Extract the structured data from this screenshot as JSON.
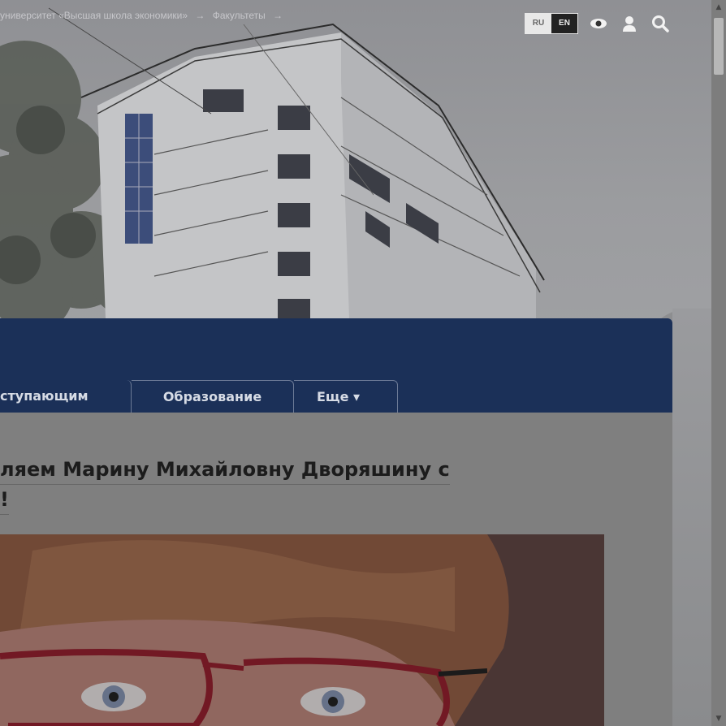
{
  "breadcrumbs": {
    "items": [
      "университет «Высшая школа экономики»",
      "→",
      "Факультеты",
      "→"
    ]
  },
  "header_utils": {
    "lang_ru": "RU",
    "lang_en": "EN"
  },
  "nav": {
    "tabs": [
      {
        "label": "ступающим"
      },
      {
        "label": "Образование"
      },
      {
        "label": "Еще ▾"
      }
    ]
  },
  "article": {
    "title_line1": "ляем Марину Михайловну Дворяшину с",
    "title_line2": "!"
  },
  "colors": {
    "header_band": "#1b3058",
    "panel": "#7f7f7f"
  },
  "icons": [
    "eye-icon",
    "user-icon",
    "search-icon"
  ]
}
